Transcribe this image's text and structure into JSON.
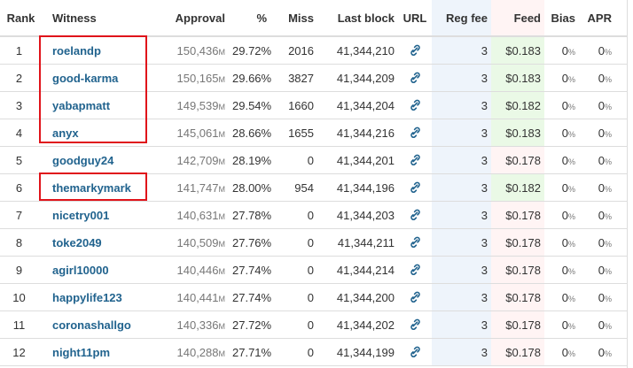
{
  "table": {
    "headers": {
      "rank": "Rank",
      "witness": "Witness",
      "approval": "Approval",
      "pct": "%",
      "miss": "Miss",
      "last_block": "Last block",
      "url": "URL",
      "reg_fee": "Reg fee",
      "feed": "Feed",
      "bias": "Bias",
      "apr": "APR"
    },
    "approval_unit": "M",
    "pct_unit": "%",
    "rows": [
      {
        "rank": "1",
        "witness": "roelandp",
        "approval": "150,436",
        "pct": "29.72%",
        "miss": "2016",
        "last_block": "41,344,210",
        "reg_fee": "3",
        "feed": "$0.183",
        "bias": "0",
        "apr": "0"
      },
      {
        "rank": "2",
        "witness": "good-karma",
        "approval": "150,165",
        "pct": "29.66%",
        "miss": "3827",
        "last_block": "41,344,209",
        "reg_fee": "3",
        "feed": "$0.183",
        "bias": "0",
        "apr": "0"
      },
      {
        "rank": "3",
        "witness": "yabapmatt",
        "approval": "149,539",
        "pct": "29.54%",
        "miss": "1660",
        "last_block": "41,344,204",
        "reg_fee": "3",
        "feed": "$0.182",
        "bias": "0",
        "apr": "0"
      },
      {
        "rank": "4",
        "witness": "anyx",
        "approval": "145,061",
        "pct": "28.66%",
        "miss": "1655",
        "last_block": "41,344,216",
        "reg_fee": "3",
        "feed": "$0.183",
        "bias": "0",
        "apr": "0"
      },
      {
        "rank": "5",
        "witness": "goodguy24",
        "approval": "142,709",
        "pct": "28.19%",
        "miss": "0",
        "last_block": "41,344,201",
        "reg_fee": "3",
        "feed": "$0.178",
        "bias": "0",
        "apr": "0"
      },
      {
        "rank": "6",
        "witness": "themarkymark",
        "approval": "141,747",
        "pct": "28.00%",
        "miss": "954",
        "last_block": "41,344,196",
        "reg_fee": "3",
        "feed": "$0.182",
        "bias": "0",
        "apr": "0"
      },
      {
        "rank": "7",
        "witness": "nicetry001",
        "approval": "140,631",
        "pct": "27.78%",
        "miss": "0",
        "last_block": "41,344,203",
        "reg_fee": "3",
        "feed": "$0.178",
        "bias": "0",
        "apr": "0"
      },
      {
        "rank": "8",
        "witness": "toke2049",
        "approval": "140,509",
        "pct": "27.76%",
        "miss": "0",
        "last_block": "41,344,211",
        "reg_fee": "3",
        "feed": "$0.178",
        "bias": "0",
        "apr": "0"
      },
      {
        "rank": "9",
        "witness": "agirl10000",
        "approval": "140,446",
        "pct": "27.74%",
        "miss": "0",
        "last_block": "41,344,214",
        "reg_fee": "3",
        "feed": "$0.178",
        "bias": "0",
        "apr": "0"
      },
      {
        "rank": "10",
        "witness": "happylife123",
        "approval": "140,441",
        "pct": "27.74%",
        "miss": "0",
        "last_block": "41,344,200",
        "reg_fee": "3",
        "feed": "$0.178",
        "bias": "0",
        "apr": "0"
      },
      {
        "rank": "11",
        "witness": "coronashallgo",
        "approval": "140,336",
        "pct": "27.72%",
        "miss": "0",
        "last_block": "41,344,202",
        "reg_fee": "3",
        "feed": "$0.178",
        "bias": "0",
        "apr": "0"
      },
      {
        "rank": "12",
        "witness": "night11pm",
        "approval": "140,288",
        "pct": "27.71%",
        "miss": "0",
        "last_block": "41,344,199",
        "reg_fee": "3",
        "feed": "$0.178",
        "bias": "0",
        "apr": "0"
      }
    ],
    "current_feed_rows": [
      0,
      1,
      2,
      3,
      5
    ]
  },
  "colors": {
    "witness_link": "#21638e",
    "highlight_box": "#e0131a",
    "feed_current_bg": "#eaf9e6",
    "feed_bg": "#fff4f4",
    "reg_fee_bg": "#eef4fb"
  },
  "icons": {
    "url": "link-icon"
  }
}
